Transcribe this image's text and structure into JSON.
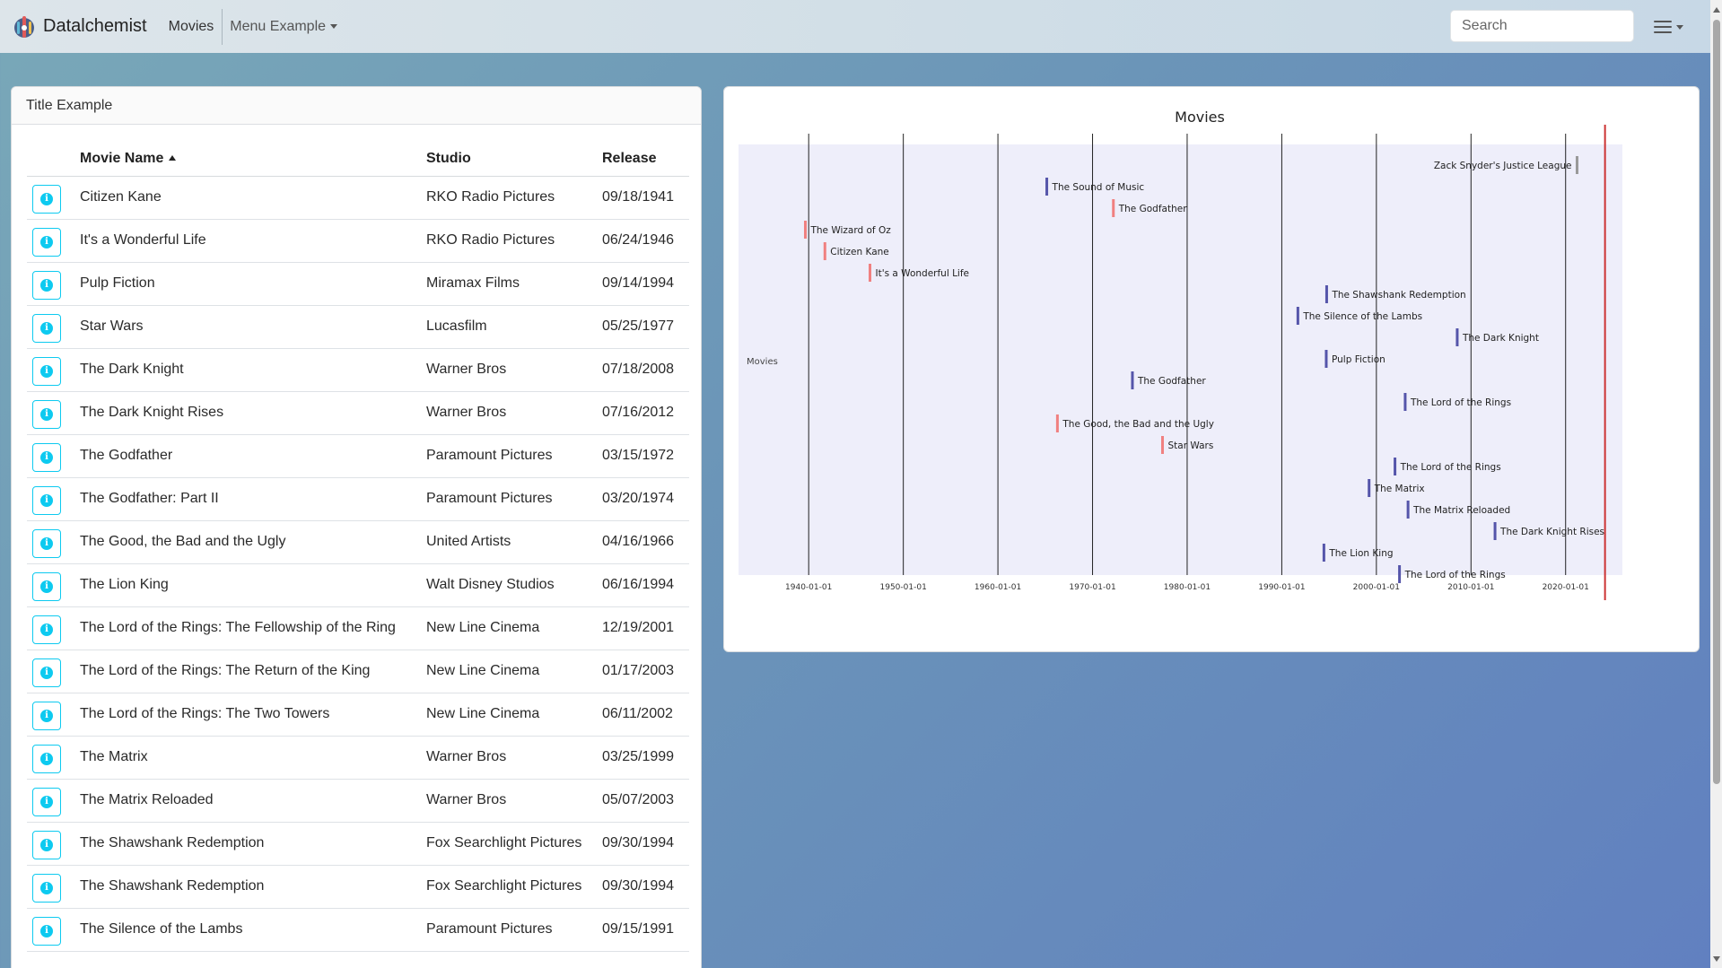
{
  "navbar": {
    "brand": "Datalchemist",
    "link_movies": "Movies",
    "menu_example": "Menu Example",
    "search_placeholder": "Search"
  },
  "left_card": {
    "title": "Title Example",
    "columns": [
      "Movie Name",
      "Studio",
      "Release"
    ],
    "rows": [
      {
        "name": "Citizen Kane",
        "studio": "RKO Radio Pictures",
        "release": "09/18/1941"
      },
      {
        "name": "It's a Wonderful Life",
        "studio": "RKO Radio Pictures",
        "release": "06/24/1946"
      },
      {
        "name": "Pulp Fiction",
        "studio": "Miramax Films",
        "release": "09/14/1994"
      },
      {
        "name": "Star Wars",
        "studio": "Lucasfilm",
        "release": "05/25/1977"
      },
      {
        "name": "The Dark Knight",
        "studio": "Warner Bros",
        "release": "07/18/2008"
      },
      {
        "name": "The Dark Knight Rises",
        "studio": "Warner Bros",
        "release": "07/16/2012"
      },
      {
        "name": "The Godfather",
        "studio": "Paramount Pictures",
        "release": "03/15/1972"
      },
      {
        "name": "The Godfather: Part II",
        "studio": "Paramount Pictures",
        "release": "03/20/1974"
      },
      {
        "name": "The Good, the Bad and the Ugly",
        "studio": "United Artists",
        "release": "04/16/1966"
      },
      {
        "name": "The Lion King",
        "studio": "Walt Disney Studios",
        "release": "06/16/1994"
      },
      {
        "name": "The Lord of the Rings: The Fellowship of the Ring",
        "studio": "New Line Cinema",
        "release": "12/19/2001"
      },
      {
        "name": "The Lord of the Rings: The Return of the King",
        "studio": "New Line Cinema",
        "release": "01/17/2003"
      },
      {
        "name": "The Lord of the Rings: The Two Towers",
        "studio": "New Line Cinema",
        "release": "06/11/2002"
      },
      {
        "name": "The Matrix",
        "studio": "Warner Bros",
        "release": "03/25/1999"
      },
      {
        "name": "The Matrix Reloaded",
        "studio": "Warner Bros",
        "release": "05/07/2003"
      },
      {
        "name": "The Shawshank Redemption",
        "studio": "Fox Searchlight Pictures",
        "release": "09/30/1994"
      },
      {
        "name": "The Shawshank Redemption",
        "studio": "Fox Searchlight Pictures",
        "release": "09/30/1994"
      },
      {
        "name": "The Silence of the Lambs",
        "studio": "Paramount Pictures",
        "release": "09/15/1991"
      }
    ]
  },
  "chart_data": {
    "type": "timeline",
    "title": "Movies",
    "group_label": "Movies",
    "x_axis": "date",
    "xlim": [
      "1932-08-01",
      "2026-01-01"
    ],
    "ticks": [
      "1940-01-01",
      "1950-01-01",
      "1960-01-01",
      "1970-01-01",
      "1980-01-01",
      "1990-01-01",
      "2000-01-01",
      "2010-01-01",
      "2020-01-01"
    ],
    "current_marker": "2024-03-01",
    "colors": {
      "blue": "#5555aa",
      "red": "#f08080",
      "gray": "#999999",
      "plot_bg": "#eeeefa",
      "marker": "#cc3333"
    },
    "items": [
      {
        "label": "Zack Snyder's Justice League",
        "date": "2021-03-18",
        "color": "gray",
        "label_side": "left"
      },
      {
        "label": "The Sound of Music",
        "date": "1965-03-02",
        "color": "blue"
      },
      {
        "label": "The Godfather",
        "date": "1972-03-15",
        "color": "red"
      },
      {
        "label": "The Wizard of Oz",
        "date": "1939-08-25",
        "color": "red"
      },
      {
        "label": "Citizen Kane",
        "date": "1941-09-18",
        "color": "red"
      },
      {
        "label": "It's a Wonderful Life",
        "date": "1946-06-24",
        "color": "red"
      },
      {
        "label": "The Shawshank Redemption",
        "date": "1994-09-30",
        "color": "blue"
      },
      {
        "label": "The Silence of the Lambs",
        "date": "1991-09-15",
        "color": "blue"
      },
      {
        "label": "The Dark Knight",
        "date": "2008-07-18",
        "color": "blue"
      },
      {
        "label": "Pulp Fiction",
        "date": "1994-09-14",
        "color": "blue"
      },
      {
        "label": "The Godfather",
        "date": "1974-03-20",
        "color": "blue"
      },
      {
        "label": "The Lord of the Rings",
        "date": "2003-01-17",
        "color": "blue"
      },
      {
        "label": "The Good, the Bad and the Ugly",
        "date": "1966-04-16",
        "color": "red"
      },
      {
        "label": "Star Wars",
        "date": "1977-05-25",
        "color": "red"
      },
      {
        "label": "The Lord of the Rings",
        "date": "2001-12-19",
        "color": "blue"
      },
      {
        "label": "The Matrix",
        "date": "1999-03-25",
        "color": "blue"
      },
      {
        "label": "The Matrix Reloaded",
        "date": "2003-05-07",
        "color": "blue"
      },
      {
        "label": "The Dark Knight Rises",
        "date": "2012-07-16",
        "color": "blue"
      },
      {
        "label": "The Lion King",
        "date": "1994-06-16",
        "color": "blue"
      },
      {
        "label": "The Lord of the Rings",
        "date": "2002-06-11",
        "color": "blue"
      }
    ]
  }
}
